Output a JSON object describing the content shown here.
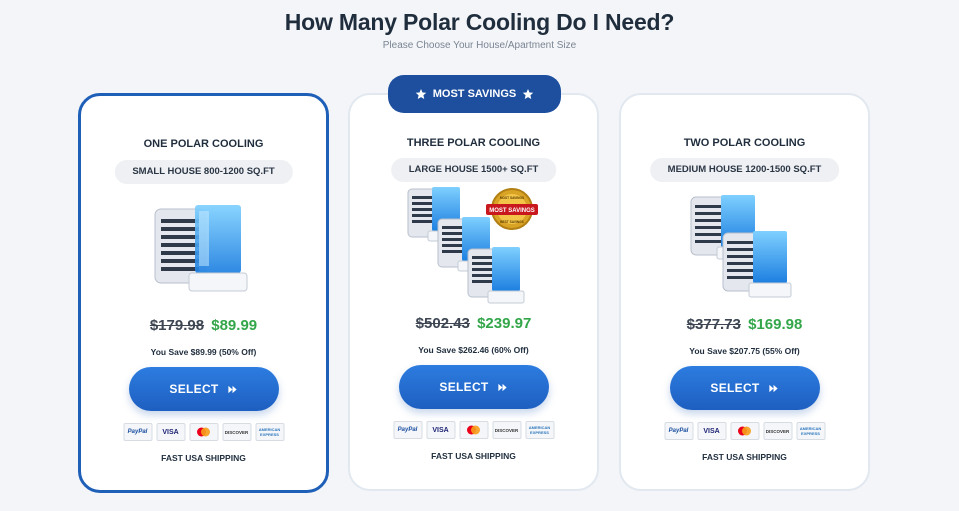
{
  "header": {
    "title": "How Many Polar Cooling Do I Need?",
    "subtitle": "Please Choose Your House/Apartment Size"
  },
  "ribbon": {
    "label": "MOST SAVINGS"
  },
  "badge": {
    "top": "MOST SAVINGS",
    "main": "MOST SAVINGS",
    "bottom": "BEST SAVINGS"
  },
  "cards": [
    {
      "title": "ONE POLAR COOLING",
      "size": "SMALL HOUSE 800-1200 SQ.FT",
      "old_price": "$179.98",
      "new_price": "$89.99",
      "savings": "You Save $89.99 (50% Off)",
      "button": "SELECT",
      "shipping": "FAST USA SHIPPING",
      "selected": true
    },
    {
      "title": "THREE POLAR COOLING",
      "size": "LARGE HOUSE 1500+ SQ.FT",
      "old_price": "$502.43",
      "new_price": "$239.97",
      "savings": "You Save $262.46 (60% Off)",
      "button": "SELECT",
      "shipping": "FAST USA SHIPPING",
      "selected": false
    },
    {
      "title": "TWO POLAR COOLING",
      "size": "MEDIUM HOUSE 1200-1500 SQ.FT",
      "old_price": "$377.73",
      "new_price": "$169.98",
      "savings": "You Save $207.75 (55% Off)",
      "button": "SELECT",
      "shipping": "FAST USA SHIPPING",
      "selected": false
    }
  ],
  "payment_methods": {
    "paypal": "PayPal",
    "visa": "VISA",
    "mastercard": "mastercard-icon",
    "discover": "DISCOVER",
    "amex": "AMERICAN EXPRESS"
  },
  "colors": {
    "brand_blue": "#1e5fb8",
    "price_green": "#33a64a",
    "ribbon_blue": "#1d4f9e"
  }
}
